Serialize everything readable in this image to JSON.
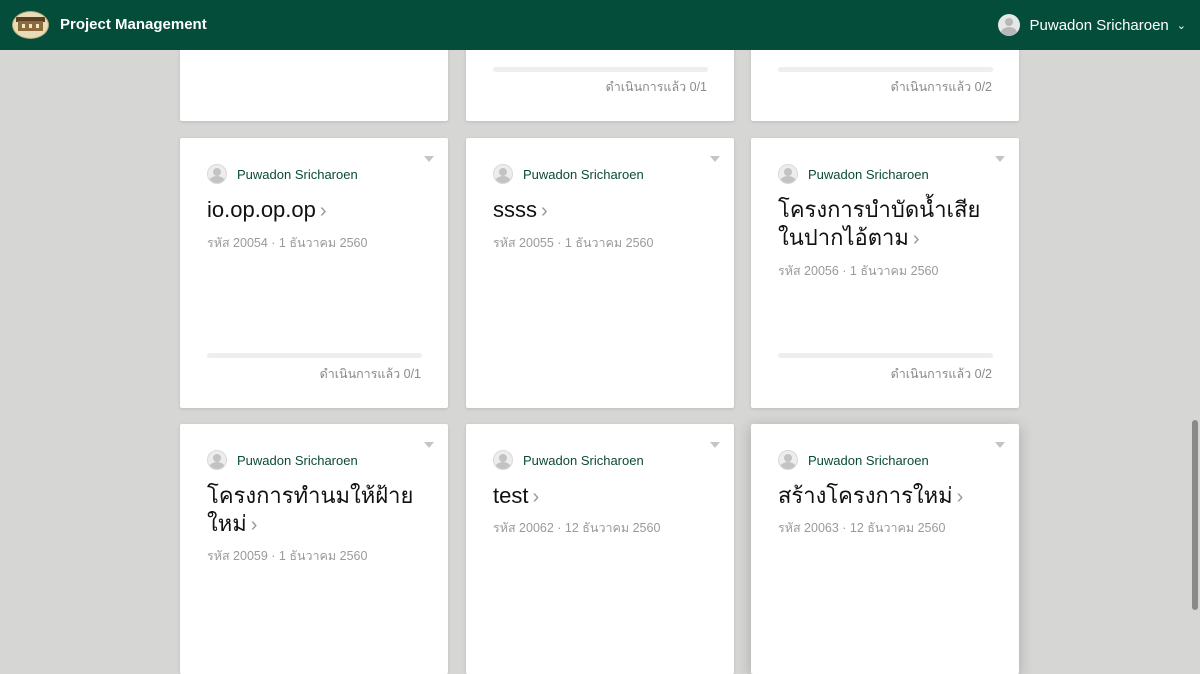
{
  "header": {
    "app_title": "Project Management",
    "user_name": "Puwadon Sricharoen",
    "colors": {
      "bar": "#034d3a",
      "text": "#ffffff"
    }
  },
  "cards": [
    {
      "progress_label": "ดำเนินการแล้ว 0/1",
      "progress_value": 0
    },
    {
      "progress_label": "ดำเนินการแล้ว 0/2",
      "progress_value": 0
    },
    {
      "owner": "Puwadon Sricharoen",
      "title": "io.op.op.op",
      "meta": "รหัส 20054 · 1 ธันวาคม 2560",
      "progress_label": "ดำเนินการแล้ว 0/1",
      "progress_value": 0
    },
    {
      "owner": "Puwadon Sricharoen",
      "title": "ssss",
      "meta": "รหัส 20055 · 1 ธันวาคม 2560"
    },
    {
      "owner": "Puwadon Sricharoen",
      "title": "โครงการบำบัดน้ำเสียในปากไอ้ตาม",
      "meta": "รหัส 20056 · 1 ธันวาคม 2560",
      "progress_label": "ดำเนินการแล้ว 0/2",
      "progress_value": 0
    },
    {
      "owner": "Puwadon Sricharoen",
      "title": "โครงการทำนมให้ฝ้ายใหม่",
      "meta": "รหัส 20059 · 1 ธันวาคม 2560"
    },
    {
      "owner": "Puwadon Sricharoen",
      "title": "test",
      "meta": "รหัส 20062 · 12 ธันวาคม 2560"
    },
    {
      "owner": "Puwadon Sricharoen",
      "title": "สร้างโครงการใหม่",
      "meta": "รหัส 20063 · 12 ธันวาคม 2560"
    }
  ],
  "icons": {
    "logo": "university-logo-icon",
    "user_avatar": "user-avatar-icon",
    "dropdown": "chevron-down-icon",
    "card_menu": "caret-down-icon",
    "title_arrow": "chevron-right-icon"
  }
}
